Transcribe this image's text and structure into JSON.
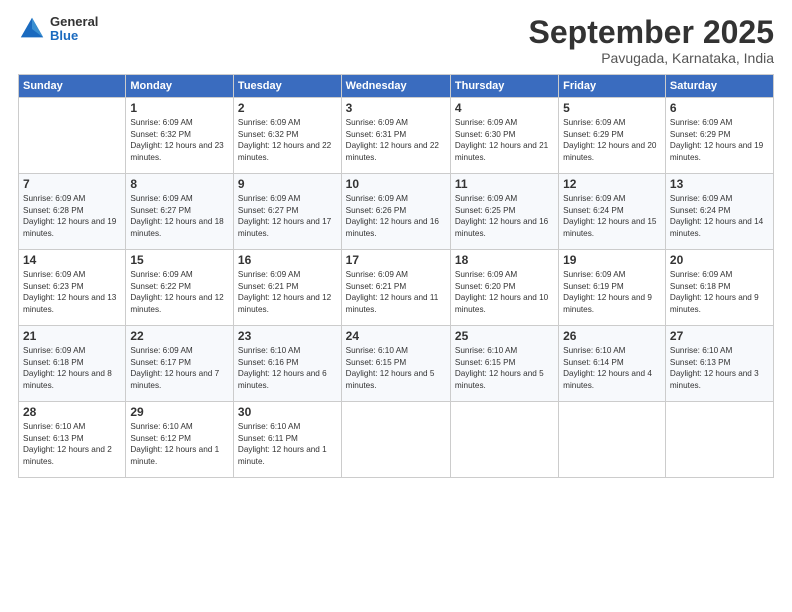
{
  "logo": {
    "general": "General",
    "blue": "Blue"
  },
  "title": "September 2025",
  "location": "Pavugada, Karnataka, India",
  "headers": [
    "Sunday",
    "Monday",
    "Tuesday",
    "Wednesday",
    "Thursday",
    "Friday",
    "Saturday"
  ],
  "weeks": [
    [
      {
        "day": "",
        "sunrise": "",
        "sunset": "",
        "daylight": ""
      },
      {
        "day": "1",
        "sunrise": "Sunrise: 6:09 AM",
        "sunset": "Sunset: 6:32 PM",
        "daylight": "Daylight: 12 hours and 23 minutes."
      },
      {
        "day": "2",
        "sunrise": "Sunrise: 6:09 AM",
        "sunset": "Sunset: 6:32 PM",
        "daylight": "Daylight: 12 hours and 22 minutes."
      },
      {
        "day": "3",
        "sunrise": "Sunrise: 6:09 AM",
        "sunset": "Sunset: 6:31 PM",
        "daylight": "Daylight: 12 hours and 22 minutes."
      },
      {
        "day": "4",
        "sunrise": "Sunrise: 6:09 AM",
        "sunset": "Sunset: 6:30 PM",
        "daylight": "Daylight: 12 hours and 21 minutes."
      },
      {
        "day": "5",
        "sunrise": "Sunrise: 6:09 AM",
        "sunset": "Sunset: 6:29 PM",
        "daylight": "Daylight: 12 hours and 20 minutes."
      },
      {
        "day": "6",
        "sunrise": "Sunrise: 6:09 AM",
        "sunset": "Sunset: 6:29 PM",
        "daylight": "Daylight: 12 hours and 19 minutes."
      }
    ],
    [
      {
        "day": "7",
        "sunrise": "Sunrise: 6:09 AM",
        "sunset": "Sunset: 6:28 PM",
        "daylight": "Daylight: 12 hours and 19 minutes."
      },
      {
        "day": "8",
        "sunrise": "Sunrise: 6:09 AM",
        "sunset": "Sunset: 6:27 PM",
        "daylight": "Daylight: 12 hours and 18 minutes."
      },
      {
        "day": "9",
        "sunrise": "Sunrise: 6:09 AM",
        "sunset": "Sunset: 6:27 PM",
        "daylight": "Daylight: 12 hours and 17 minutes."
      },
      {
        "day": "10",
        "sunrise": "Sunrise: 6:09 AM",
        "sunset": "Sunset: 6:26 PM",
        "daylight": "Daylight: 12 hours and 16 minutes."
      },
      {
        "day": "11",
        "sunrise": "Sunrise: 6:09 AM",
        "sunset": "Sunset: 6:25 PM",
        "daylight": "Daylight: 12 hours and 16 minutes."
      },
      {
        "day": "12",
        "sunrise": "Sunrise: 6:09 AM",
        "sunset": "Sunset: 6:24 PM",
        "daylight": "Daylight: 12 hours and 15 minutes."
      },
      {
        "day": "13",
        "sunrise": "Sunrise: 6:09 AM",
        "sunset": "Sunset: 6:24 PM",
        "daylight": "Daylight: 12 hours and 14 minutes."
      }
    ],
    [
      {
        "day": "14",
        "sunrise": "Sunrise: 6:09 AM",
        "sunset": "Sunset: 6:23 PM",
        "daylight": "Daylight: 12 hours and 13 minutes."
      },
      {
        "day": "15",
        "sunrise": "Sunrise: 6:09 AM",
        "sunset": "Sunset: 6:22 PM",
        "daylight": "Daylight: 12 hours and 12 minutes."
      },
      {
        "day": "16",
        "sunrise": "Sunrise: 6:09 AM",
        "sunset": "Sunset: 6:21 PM",
        "daylight": "Daylight: 12 hours and 12 minutes."
      },
      {
        "day": "17",
        "sunrise": "Sunrise: 6:09 AM",
        "sunset": "Sunset: 6:21 PM",
        "daylight": "Daylight: 12 hours and 11 minutes."
      },
      {
        "day": "18",
        "sunrise": "Sunrise: 6:09 AM",
        "sunset": "Sunset: 6:20 PM",
        "daylight": "Daylight: 12 hours and 10 minutes."
      },
      {
        "day": "19",
        "sunrise": "Sunrise: 6:09 AM",
        "sunset": "Sunset: 6:19 PM",
        "daylight": "Daylight: 12 hours and 9 minutes."
      },
      {
        "day": "20",
        "sunrise": "Sunrise: 6:09 AM",
        "sunset": "Sunset: 6:18 PM",
        "daylight": "Daylight: 12 hours and 9 minutes."
      }
    ],
    [
      {
        "day": "21",
        "sunrise": "Sunrise: 6:09 AM",
        "sunset": "Sunset: 6:18 PM",
        "daylight": "Daylight: 12 hours and 8 minutes."
      },
      {
        "day": "22",
        "sunrise": "Sunrise: 6:09 AM",
        "sunset": "Sunset: 6:17 PM",
        "daylight": "Daylight: 12 hours and 7 minutes."
      },
      {
        "day": "23",
        "sunrise": "Sunrise: 6:10 AM",
        "sunset": "Sunset: 6:16 PM",
        "daylight": "Daylight: 12 hours and 6 minutes."
      },
      {
        "day": "24",
        "sunrise": "Sunrise: 6:10 AM",
        "sunset": "Sunset: 6:15 PM",
        "daylight": "Daylight: 12 hours and 5 minutes."
      },
      {
        "day": "25",
        "sunrise": "Sunrise: 6:10 AM",
        "sunset": "Sunset: 6:15 PM",
        "daylight": "Daylight: 12 hours and 5 minutes."
      },
      {
        "day": "26",
        "sunrise": "Sunrise: 6:10 AM",
        "sunset": "Sunset: 6:14 PM",
        "daylight": "Daylight: 12 hours and 4 minutes."
      },
      {
        "day": "27",
        "sunrise": "Sunrise: 6:10 AM",
        "sunset": "Sunset: 6:13 PM",
        "daylight": "Daylight: 12 hours and 3 minutes."
      }
    ],
    [
      {
        "day": "28",
        "sunrise": "Sunrise: 6:10 AM",
        "sunset": "Sunset: 6:13 PM",
        "daylight": "Daylight: 12 hours and 2 minutes."
      },
      {
        "day": "29",
        "sunrise": "Sunrise: 6:10 AM",
        "sunset": "Sunset: 6:12 PM",
        "daylight": "Daylight: 12 hours and 1 minute."
      },
      {
        "day": "30",
        "sunrise": "Sunrise: 6:10 AM",
        "sunset": "Sunset: 6:11 PM",
        "daylight": "Daylight: 12 hours and 1 minute."
      },
      {
        "day": "",
        "sunrise": "",
        "sunset": "",
        "daylight": ""
      },
      {
        "day": "",
        "sunrise": "",
        "sunset": "",
        "daylight": ""
      },
      {
        "day": "",
        "sunrise": "",
        "sunset": "",
        "daylight": ""
      },
      {
        "day": "",
        "sunrise": "",
        "sunset": "",
        "daylight": ""
      }
    ]
  ]
}
